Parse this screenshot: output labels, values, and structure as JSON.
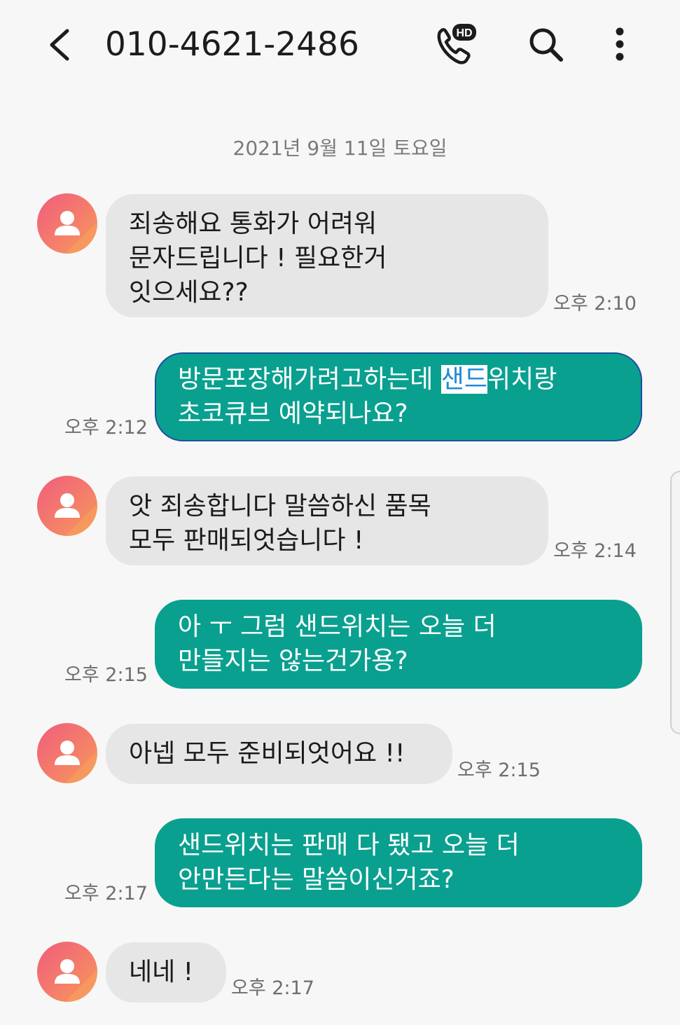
{
  "header": {
    "title": "010-4621-2486",
    "back_icon": "back-arrow-icon",
    "call_icon": "hd-call-icon",
    "call_badge": "HD",
    "search_icon": "search-icon",
    "more_icon": "more-vertical-icon"
  },
  "date_separator": "2021년 9월 11일 토요일",
  "colors": {
    "incoming_bubble": "#e6e6e6",
    "outgoing_bubble": "#0aa08f",
    "avatar_start": "#f05c7e",
    "avatar_end": "#f79a5a",
    "highlight_text": "#1f8ad8"
  },
  "messages": [
    {
      "direction": "incoming",
      "lines": [
        "죄송해요 통화가 어려워",
        "문자드립니다 ! 필요한거",
        "잇으세요??"
      ],
      "time": "오후 2:10"
    },
    {
      "direction": "outgoing",
      "lines": [
        "방문포장해가려고하는데 ",
        "샌드",
        "위치랑",
        "초코큐브 예약되나요?"
      ],
      "time": "오후 2:12",
      "selected_text": "샌드"
    },
    {
      "direction": "incoming",
      "lines": [
        "앗 죄송합니다 말씀하신 품목",
        "모두 판매되엇습니다 !"
      ],
      "time": "오후 2:14"
    },
    {
      "direction": "outgoing",
      "lines": [
        "아 ㅜ 그럼 샌드위치는 오늘 더",
        "만들지는 않는건가용?"
      ],
      "time": "오후 2:15"
    },
    {
      "direction": "incoming",
      "lines": [
        "아넵 모두 준비되엇어요 !!"
      ],
      "time": "오후 2:15"
    },
    {
      "direction": "outgoing",
      "lines": [
        "샌드위치는 판매 다 됐고 오늘 더",
        "안만든다는 말씀이신거죠?"
      ],
      "time": "오후 2:17"
    },
    {
      "direction": "incoming",
      "lines": [
        "네네 !"
      ],
      "time": "오후 2:17"
    }
  ]
}
